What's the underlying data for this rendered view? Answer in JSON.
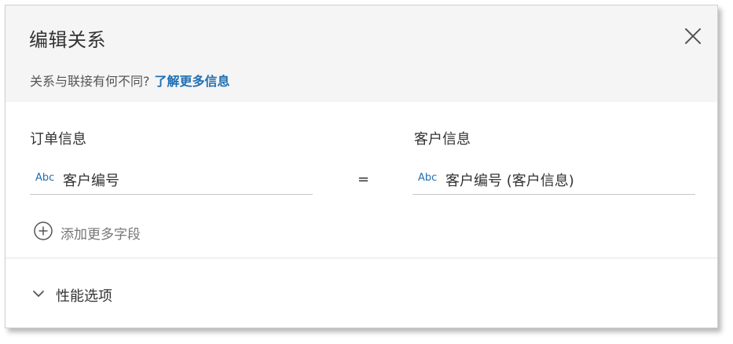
{
  "dialog": {
    "title": "编辑关系",
    "subtitle_question": "关系与联接有何不同?",
    "subtitle_link": "了解更多信息",
    "close_icon": "close-icon"
  },
  "relationship": {
    "left_table_label": "订单信息",
    "right_table_label": "客户信息",
    "operator": "=",
    "left_field": {
      "type_label": "Abc",
      "name": "客户编号"
    },
    "right_field": {
      "type_label": "Abc",
      "name": "客户编号 (客户信息)"
    },
    "add_more_label": "添加更多字段",
    "add_icon": "plus-circle-icon"
  },
  "performance": {
    "label": "性能选项",
    "expanded": false,
    "toggle_icon": "chevron-down-icon"
  },
  "colors": {
    "accent": "#1f6fb2",
    "header_bg": "#f5f5f5",
    "text": "#333333",
    "muted_text": "#777777"
  }
}
